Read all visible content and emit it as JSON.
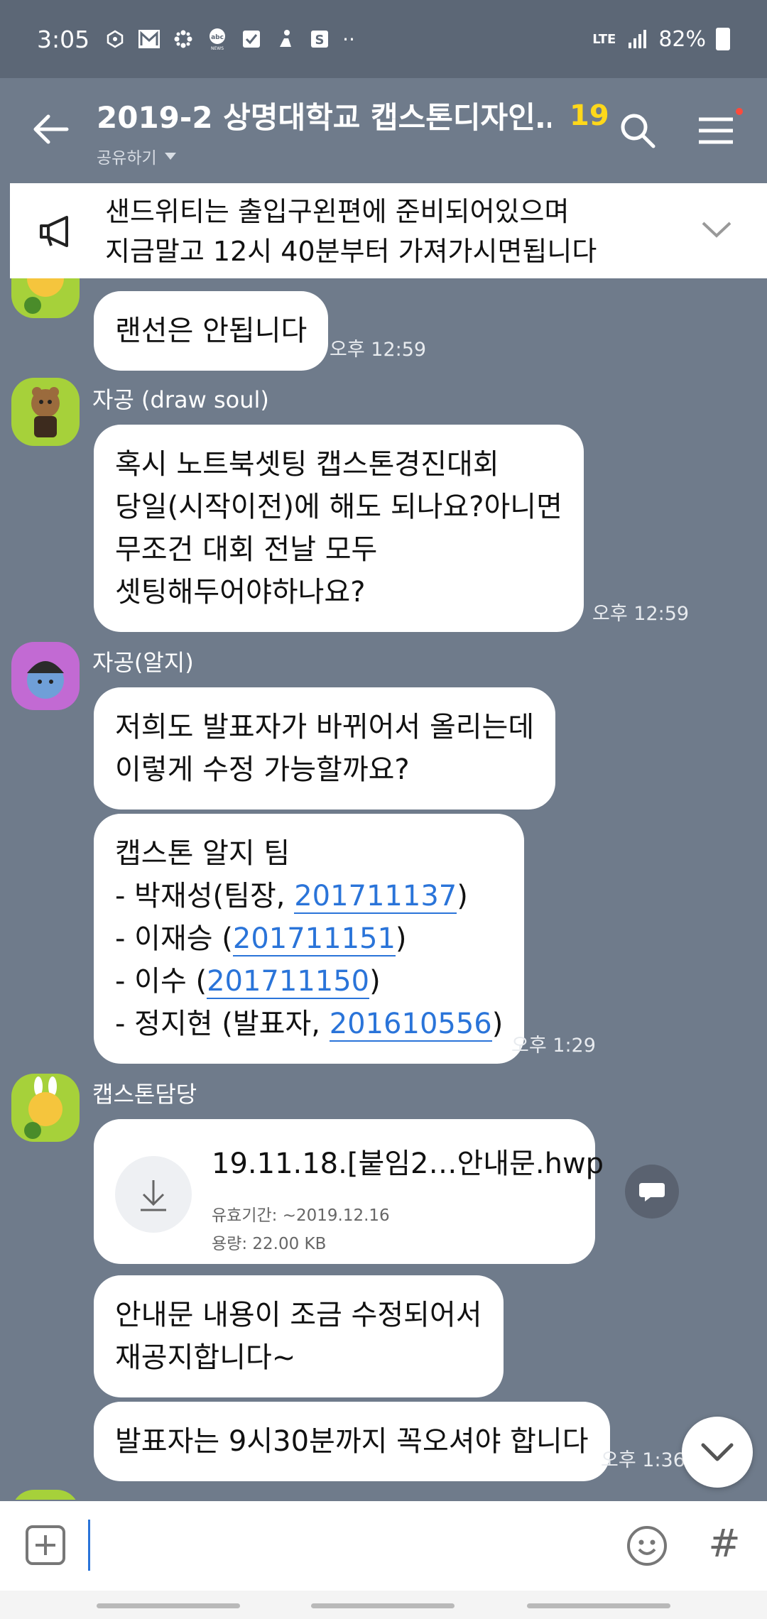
{
  "status_bar": {
    "time": "3:05",
    "network": "LTE",
    "battery": "82%",
    "more": "··"
  },
  "header": {
    "title": "2019-2 상명대학교 캡스톤디자인…",
    "member_count": "19",
    "share_label": "공유하기"
  },
  "notice": {
    "line1": "샌드위티는 출입구왼편에 준비되어있으며",
    "line2": "지금말고 12시 40분부터 가져가시면됩니다"
  },
  "messages": {
    "m1": {
      "text": "랜선은 안됩니다",
      "time": "오후 12:59"
    },
    "m2": {
      "sender": "자공 (draw soul)",
      "lines": [
        "혹시 노트북셋팅 캡스톤경진대회",
        "당일(시작이전)에 해도 되나요?아니면",
        "무조건 대회 전날 모두",
        "셋팅해두어야하나요?"
      ],
      "time": "오후 12:59"
    },
    "m3": {
      "sender": "자공(알지)",
      "lines": [
        "저희도 발표자가 바뀌어서 올리는데",
        "이렇게 수정 가능할까요?"
      ]
    },
    "m4": {
      "title": "캡스톤 알지 팀",
      "rows": [
        {
          "prefix": "- 박재성(팀장, ",
          "id": "201711137",
          "suffix": ")"
        },
        {
          "prefix": "- 이재승 (",
          "id": "201711151",
          "suffix": ")"
        },
        {
          "prefix": "- 이수 (",
          "id": "201711150",
          "suffix": ")"
        },
        {
          "prefix": "- 정지현 (발표자, ",
          "id": "201610556",
          "suffix": ")"
        }
      ],
      "time": "오후 1:29"
    },
    "m5": {
      "sender": "캡스톤담당",
      "file_name": "19.11.18.[붙임2…안내문.hwp",
      "expiry": "유효기간: ~2019.12.16",
      "size": "용량: 22.00 KB"
    },
    "m6": {
      "lines": [
        "안내문 내용이 조금 수정되어서",
        "재공지합니다~"
      ]
    },
    "m7": {
      "text": "발표자는 9시30분까지 꼭오셔야 합니다",
      "time": "오후 1:36"
    }
  },
  "input": {
    "placeholder": "",
    "hash": "#"
  },
  "icons": {
    "back": "arrow-left-icon",
    "search": "search-icon",
    "menu": "hamburger-menu-icon",
    "notice": "megaphone-icon",
    "download": "download-icon",
    "share": "speech-bubble-icon",
    "emoji": "smiley-icon",
    "plus": "plus-box-icon"
  },
  "colors": {
    "background": "#6f7b8b",
    "status_bar": "#5c6776",
    "member_count": "#ffd81a",
    "link": "#2a74d9",
    "notification_dot": "#ff4a3b"
  }
}
